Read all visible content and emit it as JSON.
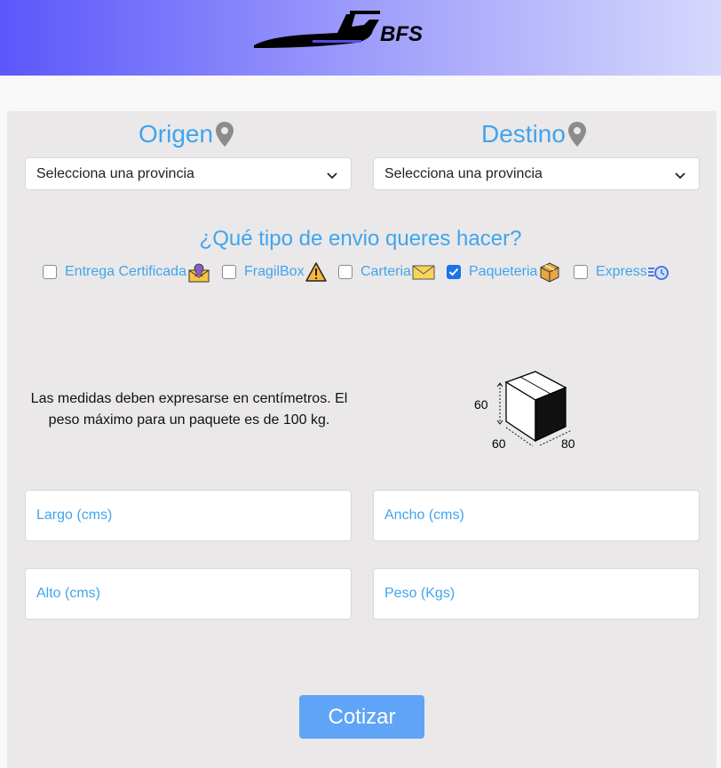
{
  "header": {
    "logo_text": "BFS",
    "gradient": [
      "#5b57fb",
      "#d6d8fc"
    ]
  },
  "origin": {
    "title": "Origen",
    "icon": "map-pin-icon",
    "select_value": "Selecciona una provincia"
  },
  "destination": {
    "title": "Destino",
    "icon": "map-pin-icon",
    "select_value": "Selecciona una provincia"
  },
  "shipping": {
    "question": "¿Qué tipo de envio queres hacer?",
    "options": [
      {
        "label": "Entrega Certificada",
        "icon": "certified-mail-icon",
        "checked": false
      },
      {
        "label": "FragilBox",
        "icon": "warning-icon",
        "checked": false
      },
      {
        "label": "Carteria",
        "icon": "envelope-icon",
        "checked": false
      },
      {
        "label": "Paqueteria",
        "icon": "package-icon",
        "checked": true
      },
      {
        "label": "Express",
        "icon": "fast-clock-icon",
        "checked": false
      }
    ]
  },
  "info": {
    "note": "Las medidas deben expresarse en centímetros. El peso máximo para un paquete es de 100 kg.",
    "figure": {
      "height": "60",
      "depth": "60",
      "width": "80"
    }
  },
  "fields": {
    "largo_placeholder": "Largo (cms)",
    "ancho_placeholder": "Ancho (cms)",
    "alto_placeholder": "Alto (cms)",
    "peso_placeholder": "Peso (Kgs)"
  },
  "actions": {
    "submit_label": "Cotizar"
  },
  "colors": {
    "accent": "#3fa5ef",
    "button": "#5fa4f7",
    "card": "#eae8e8"
  }
}
